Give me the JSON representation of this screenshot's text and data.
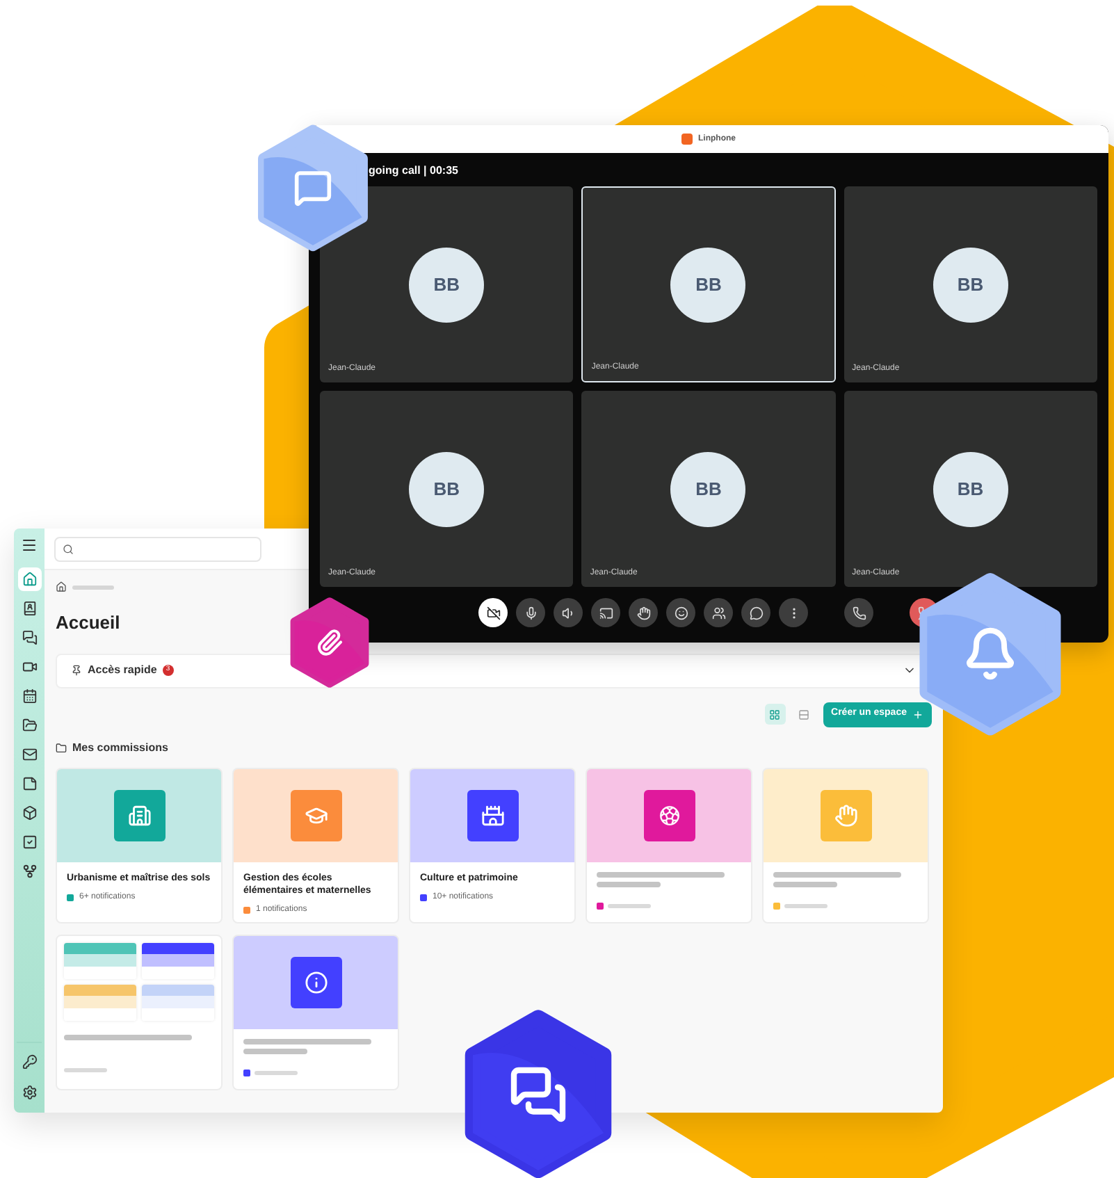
{
  "call_window": {
    "title": "Linphone",
    "header": "going call | 00:35",
    "participants": [
      {
        "initials": "BB",
        "name": "Jean-Claude",
        "selected": false
      },
      {
        "initials": "BB",
        "name": "Jean-Claude",
        "selected": true
      },
      {
        "initials": "BB",
        "name": "Jean-Claude",
        "selected": false
      },
      {
        "initials": "BB",
        "name": "Jean-Claude",
        "selected": false
      },
      {
        "initials": "BB",
        "name": "Jean-Claude",
        "selected": false
      },
      {
        "initials": "BB",
        "name": "Jean-Claude",
        "selected": false
      }
    ],
    "controls": [
      {
        "kind": "camera",
        "active": true
      },
      {
        "kind": "mic",
        "active": false
      },
      {
        "kind": "speaker",
        "active": false
      },
      {
        "kind": "cast",
        "active": false
      },
      {
        "kind": "wave",
        "active": false
      },
      {
        "kind": "emoji",
        "active": false
      },
      {
        "kind": "people",
        "active": false
      },
      {
        "kind": "chat",
        "active": false
      },
      {
        "kind": "more",
        "active": false
      },
      {
        "kind": "hold",
        "active": false
      },
      {
        "kind": "hangup",
        "active": false
      }
    ]
  },
  "app_window": {
    "sidebar": {
      "items": [
        {
          "kind": "home",
          "selected": true
        },
        {
          "kind": "contacts",
          "selected": false
        },
        {
          "kind": "chat",
          "selected": false
        },
        {
          "kind": "video",
          "selected": false
        },
        {
          "kind": "calendar",
          "selected": false
        },
        {
          "kind": "folder",
          "selected": false
        },
        {
          "kind": "mail",
          "selected": false
        },
        {
          "kind": "notes",
          "selected": false
        },
        {
          "kind": "cube",
          "selected": false
        },
        {
          "kind": "tasks",
          "selected": false
        },
        {
          "kind": "branch",
          "selected": false
        }
      ],
      "bottom_items": [
        {
          "kind": "key",
          "selected": false
        },
        {
          "kind": "settings",
          "selected": false
        }
      ]
    },
    "title": "Accueil",
    "quick_access": {
      "label": "Accès rapide",
      "badge": "3",
      "expanded": false
    },
    "view_toggles": [
      {
        "kind": "grid",
        "selected": true
      },
      {
        "kind": "list",
        "selected": false
      }
    ],
    "create_button": "Créer un espace",
    "section_title": "Mes commissions",
    "cards": [
      {
        "kind": "commission",
        "color": "#12a89a",
        "title": "Urbanisme et maîtrise des sols",
        "notifications": "6+ notifications"
      },
      {
        "kind": "commission",
        "color": "#fb8c3c",
        "title": "Gestion des écoles élémentaires et maternelles",
        "notifications": "1 notifications"
      },
      {
        "kind": "commission",
        "color": "#4340ff",
        "title": "Culture et patrimoine",
        "notifications": "10+ notifications"
      },
      {
        "kind": "skeleton",
        "color": "#e0199c"
      },
      {
        "kind": "skeleton",
        "color": "#fbbd3a"
      },
      {
        "kind": "templates",
        "previews": [
          {
            "color": "#4fc4b6"
          },
          {
            "color": "#4340ff"
          },
          {
            "color": "#f6c56a"
          },
          {
            "color": "#c3d3f8"
          }
        ]
      },
      {
        "kind": "skeleton",
        "color": "#4340ff"
      }
    ]
  }
}
